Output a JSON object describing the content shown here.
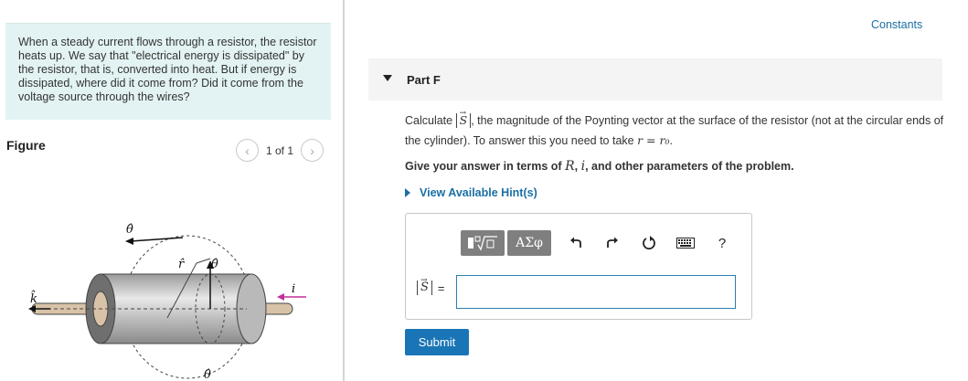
{
  "intro_text": "When a steady current flows through a resistor, the resistor heats up. We say that \"electrical energy is dissipated\" by the resistor, that is, converted into heat. But if energy is dissipated, where did it come from? Did it come from the voltage source through the wires?",
  "figure": {
    "label": "Figure",
    "pager_text": "1 of 1",
    "labels": {
      "theta_top": "θ̂",
      "r_hat": "r̂",
      "theta_mid": "θ̂",
      "k_hat": "k̂",
      "current": "i",
      "theta_bottom": "θ̂"
    }
  },
  "constants_link": "Constants",
  "part": {
    "title": "Part F"
  },
  "question": {
    "pre": "Calculate",
    "symbol": "S",
    "post_1": ", the magnitude of the Poynting vector at the surface of the resistor (not at the circular ends of the cylinder). To answer this you need to take",
    "condition": "r = r₀",
    "post_2": "."
  },
  "instruction": {
    "pre": "Give your answer in terms of",
    "var_R": "R",
    "sep": ",",
    "var_i": "i",
    "post": ", and other parameters of the problem."
  },
  "hint_link": "View Available Hint(s)",
  "toolbar": {
    "template_icon": "template-sqrt-icon",
    "greek_label": "ΑΣφ",
    "undo_icon": "undo-icon",
    "redo_icon": "redo-icon",
    "reset_icon": "reset-icon",
    "keyboard_icon": "keyboard-icon",
    "help_label": "?"
  },
  "answer": {
    "label_symbol": "S",
    "equals": "=",
    "value": ""
  },
  "submit_label": "Submit",
  "colors": {
    "link": "#1a6fa5",
    "submit": "#1a75b7",
    "intro_bg": "#e3f3f3",
    "current_arrow": "#c0309a"
  }
}
